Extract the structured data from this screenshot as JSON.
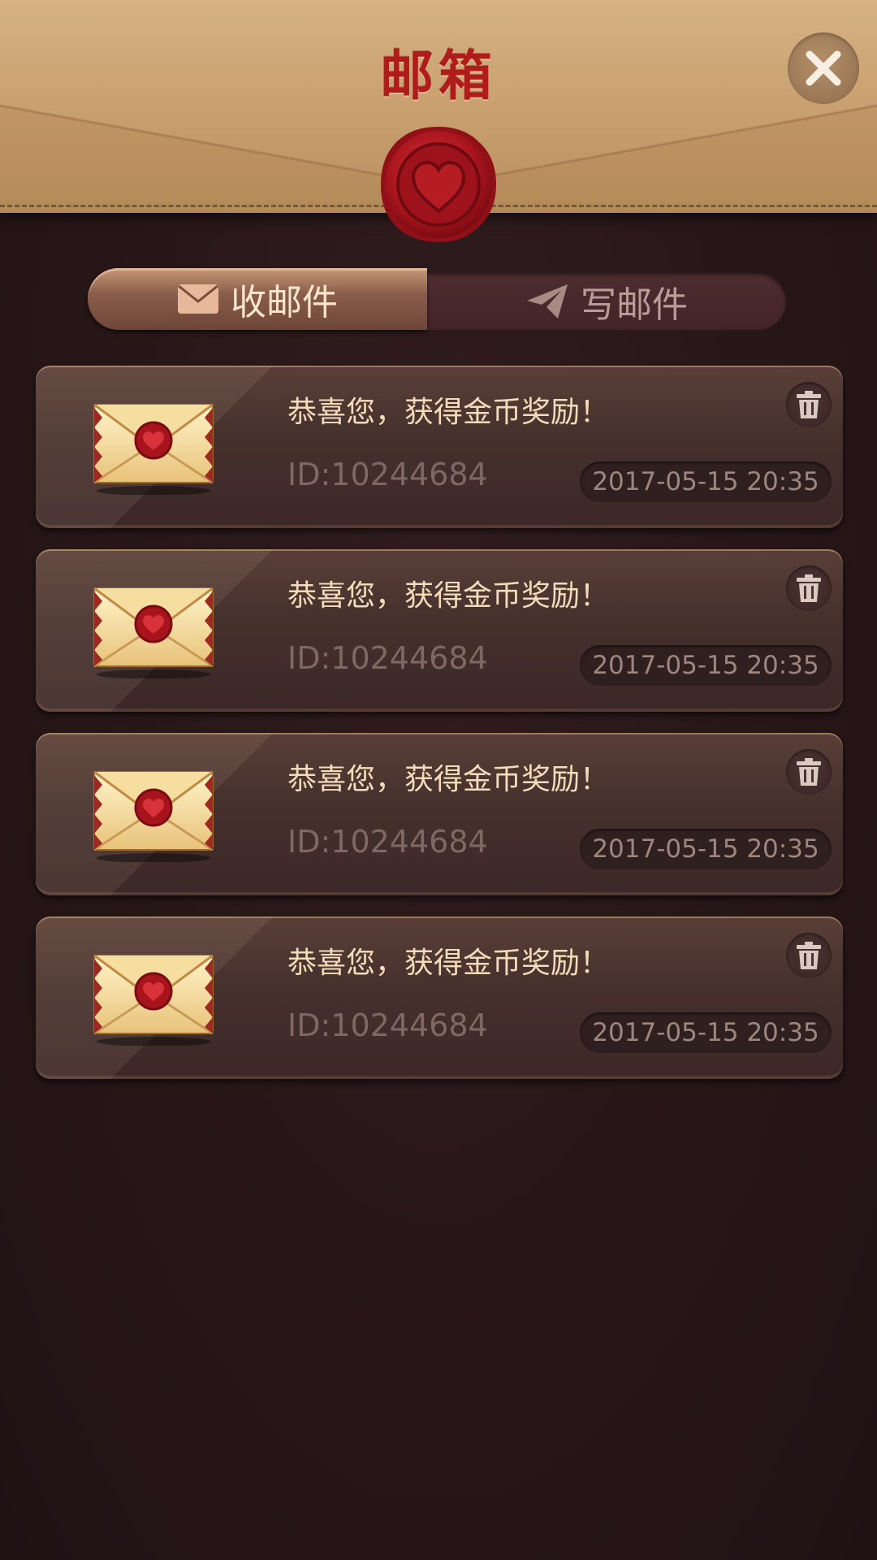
{
  "header": {
    "title": "邮箱",
    "close_icon": "close-icon",
    "seal_icon": "heart-wax-seal-icon"
  },
  "tabs": [
    {
      "label": "收邮件",
      "icon": "envelope-icon",
      "active": true
    },
    {
      "label": "写邮件",
      "icon": "paper-plane-icon",
      "active": false
    }
  ],
  "mails": [
    {
      "title": "恭喜您，获得金币奖励！",
      "id": "ID:10244684",
      "date": "2017-05-15 20:35",
      "icon": "sealed-envelope-icon",
      "delete_icon": "trash-icon"
    },
    {
      "title": "恭喜您，获得金币奖励！",
      "id": "ID:10244684",
      "date": "2017-05-15 20:35",
      "icon": "sealed-envelope-icon",
      "delete_icon": "trash-icon"
    },
    {
      "title": "恭喜您，获得金币奖励！",
      "id": "ID:10244684",
      "date": "2017-05-15 20:35",
      "icon": "sealed-envelope-icon",
      "delete_icon": "trash-icon"
    },
    {
      "title": "恭喜您，获得金币奖励！",
      "id": "ID:10244684",
      "date": "2017-05-15 20:35",
      "icon": "sealed-envelope-icon",
      "delete_icon": "trash-icon"
    }
  ],
  "colors": {
    "background": "#251517",
    "header": "#c09563",
    "title": "#b01c1c",
    "seal": "#a8141c",
    "active_tab_text": "#fbe6cc",
    "inactive_tab_text": "#b99d97",
    "mail_title": "#f4dcbb"
  }
}
